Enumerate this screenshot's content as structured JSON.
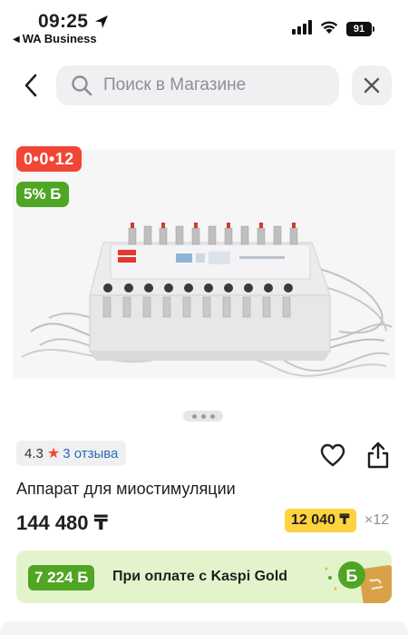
{
  "status_bar": {
    "time": "09:25",
    "back_app": "WA Business",
    "battery": "91",
    "icons": [
      "location-arrow-icon",
      "signal-icon",
      "wifi-icon",
      "battery-icon"
    ]
  },
  "header": {
    "search_placeholder": "Поиск в Магазине",
    "back_icon": "chevron-left-icon",
    "search_icon": "search-icon",
    "close_icon": "close-icon"
  },
  "product": {
    "installment_badge": "0•0•12",
    "bonus_badge": "5% Б",
    "gallery_pages": 3,
    "gallery_active_page": 1,
    "rating": "4.3",
    "reviews": "3 отзыва",
    "title": "Аппарат для миостимуляции",
    "price": "144 480 ₸",
    "monthly_payment": "12 040 ₸",
    "months": "×12"
  },
  "kaspi_gold": {
    "bonus": "7 224 Б",
    "text": "При оплате с Kaspi Gold"
  },
  "colors": {
    "accent_red": "#f14635",
    "bonus_green": "#4fa524",
    "installment_yellow": "#ffd23f",
    "gold_banner_bg": "#e3f4cc",
    "link_blue": "#2a6cb8"
  }
}
